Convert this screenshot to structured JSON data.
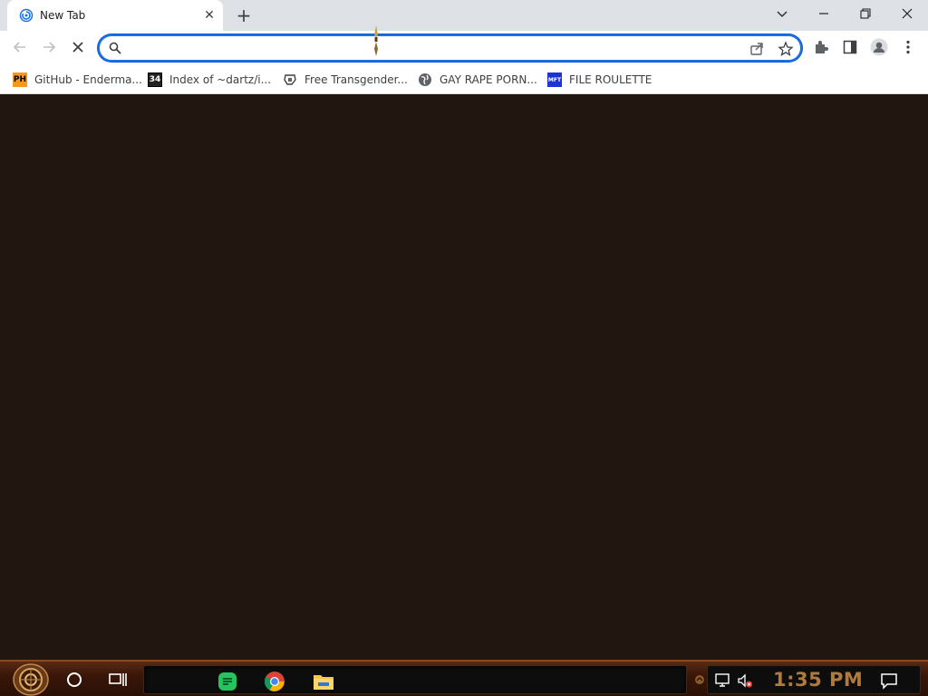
{
  "browser": {
    "tab": {
      "title": "New Tab",
      "close_label": "✕"
    },
    "new_tab_label": "+",
    "window_controls": {
      "tab_search_icon": "chevron-down-icon",
      "minimize_icon": "minimize-icon",
      "restore_icon": "restore-icon",
      "close_icon": "close-icon"
    },
    "toolbar": {
      "back_icon": "arrow-left-icon",
      "forward_icon": "arrow-right-icon",
      "stop_icon": "stop-icon"
    },
    "omnibox": {
      "value": "",
      "placeholder": ""
    },
    "bookmarks": [
      {
        "label": "GitHub - Enderma...",
        "icon": "PH"
      },
      {
        "label": "Index of ~dartz/i...",
        "icon": "34"
      },
      {
        "label": "Free Transgender...",
        "icon": ""
      },
      {
        "label": "GAY RAPE PORN...",
        "icon": ""
      },
      {
        "label": "FILE ROULETTE",
        "icon": "MFT"
      }
    ]
  },
  "taskbar": {
    "clock": "1:35 PM"
  },
  "colors": {
    "accent": "#1a73e8",
    "content_bg": "#211610",
    "clock": "#b07a3c"
  }
}
